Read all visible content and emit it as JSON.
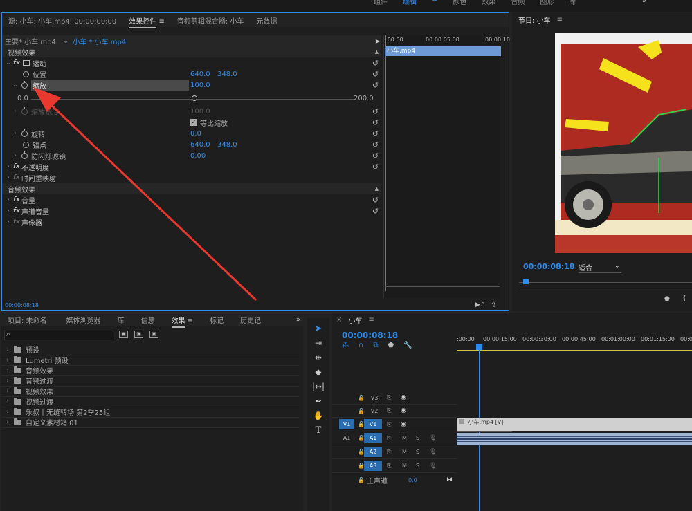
{
  "topbar": {
    "tabs": [
      "组件",
      "编辑",
      "颜色",
      "效果",
      "音频",
      "图形",
      "库"
    ],
    "more": "»"
  },
  "source_panel": {
    "tabs": [
      "源: 小车: 小车.mp4: 00:00:00:00",
      "效果控件",
      "音频剪辑混合器: 小车",
      "元数据"
    ],
    "active_tab": "效果控件",
    "menu": "≡",
    "master_label": "主要* 小车.mp4",
    "clip_selector": "小车 * 小车.mp4",
    "timecode": "00:00:08:18",
    "ruler": {
      "start": ":00:00",
      "mid": "00:00:05:00",
      "end": "00:00:10"
    },
    "clip_bar": "小车.mp4",
    "video_section": "视频效果",
    "audio_section": "音频效果",
    "effects": {
      "motion": "运动",
      "position": {
        "label": "位置",
        "x": "640.0",
        "y": "348.0"
      },
      "scale": {
        "label": "缩放",
        "value": "100.0",
        "min": "0.0",
        "max": "200.0",
        "level": 0.5
      },
      "scale_width": {
        "label": "缩放宽度",
        "value": "100.0"
      },
      "uniform": "等比缩放",
      "rotation": {
        "label": "旋转",
        "value": "0.0"
      },
      "anchor": {
        "label": "锚点",
        "x": "640.0",
        "y": "348.0"
      },
      "flicker": {
        "label": "防闪烁滤镜",
        "value": "0.00"
      },
      "opacity": "不透明度",
      "time_remap": "时间重映射",
      "volume": "音量",
      "channel_volume": "声道音量",
      "panner": "声像器"
    }
  },
  "program_panel": {
    "title": "节目: 小车",
    "menu": "≡",
    "timecode": "00:00:08:18",
    "fit": "适合",
    "fit_arrow": "⌄"
  },
  "project_panel": {
    "tabs": [
      "项目: 未命名",
      "媒体浏览器",
      "库",
      "信息",
      "效果",
      "标记",
      "历史记"
    ],
    "active_tab": "效果",
    "menu": "≡",
    "more": "»",
    "search_placeholder": "",
    "folders": [
      "预设",
      "Lumetri 预设",
      "音频效果",
      "音频过渡",
      "视频效果",
      "视频过渡",
      "乐叔丨无缝转场 第2季25组",
      "自定义素材箱 01"
    ]
  },
  "sequence_panel": {
    "title": "小车",
    "menu": "≡",
    "close": "×",
    "timecode": "00:00:08:18",
    "ruler": [
      ":00:00",
      "00:00:15:00",
      "00:00:30:00",
      "00:00:45:00",
      "00:01:00:00",
      "00:01:15:00",
      "00:0"
    ],
    "video_tracks": [
      "V3",
      "V2",
      "V1"
    ],
    "source_v": "V1",
    "audio_tracks": [
      "A1",
      "A2",
      "A3"
    ],
    "source_a": "A1",
    "master": {
      "label": "主声道",
      "value": "0.0"
    },
    "video_clip": "小车.mp4 [V]",
    "mute": "M",
    "solo": "S"
  },
  "tools": [
    "selection",
    "track-select",
    "ripple",
    "razor",
    "slip",
    "pen",
    "hand",
    "type"
  ]
}
